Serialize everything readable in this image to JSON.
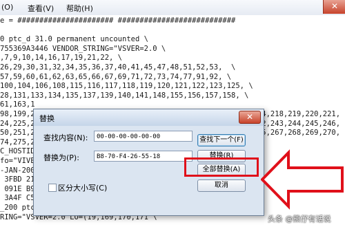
{
  "menubar": {
    "items": [
      "(O)",
      "查看(V)",
      "帮助(H)"
    ]
  },
  "window": {
    "close_glyph": "✕"
  },
  "editor": {
    "lines": [
      "e = ###################### ###########################",
      "",
      "0 ptc_d 31.0 permanent uncounted \\",
      "755369A3446 VENDOR_STRING=\"VSVER=2.0 \\",
      ",7,9,10,14,16,17,19,21,22, \\",
      "26,29,30,31,32,34,35,36,37,40,41,45,47,48,51,52,53,  \\",
      "57,59,60,61,62,63,65,66,67,69,71,72,73,74,77,91,92, \\",
      "100,104,106,108,115,116,117,118,119,120,121,122,123,125, \\",
      "28,131,133,134,135,137,139,140,141,148,155,156,157,158, \\",
      "61,163,1",
      "98,199,2                                                    4,218,219,220,221,",
      "24,225,2                                                    2,243,244,245,246,",
      "50,251,2                                                    5,267,268,269,270,",
      "74,275,2",
      "C_HOSTID",
      "fo=\"VIVE",
      "-JAN-200",
      " 3FBD 21",
      " 091E B9",
      " 3A4F C5",
      "_200 ptc_d 31.0 permanent uncounted 875BED9B1C14 \\",
      "RING=\"VSVER=2.0 LO=(19,169,170,171 \\"
    ]
  },
  "dialog": {
    "title": "替换",
    "close_glyph": "✕",
    "find_label": "查找内容(N):",
    "find_value": "00-00-00-00-00-00",
    "replace_label": "替换为(P):",
    "replace_value": "B8-70-F4-26-55-18",
    "case_label": "区分大小写(C)",
    "buttons": {
      "find_next": "查找下一个(F)",
      "replace": "替换(R)",
      "replace_all": "全部替换(A)",
      "cancel": "取消"
    }
  },
  "colors": {
    "highlight": "#e0101a",
    "dialog_bg": "#dbe5f1"
  },
  "watermark": "头条 @熊仔有话说"
}
